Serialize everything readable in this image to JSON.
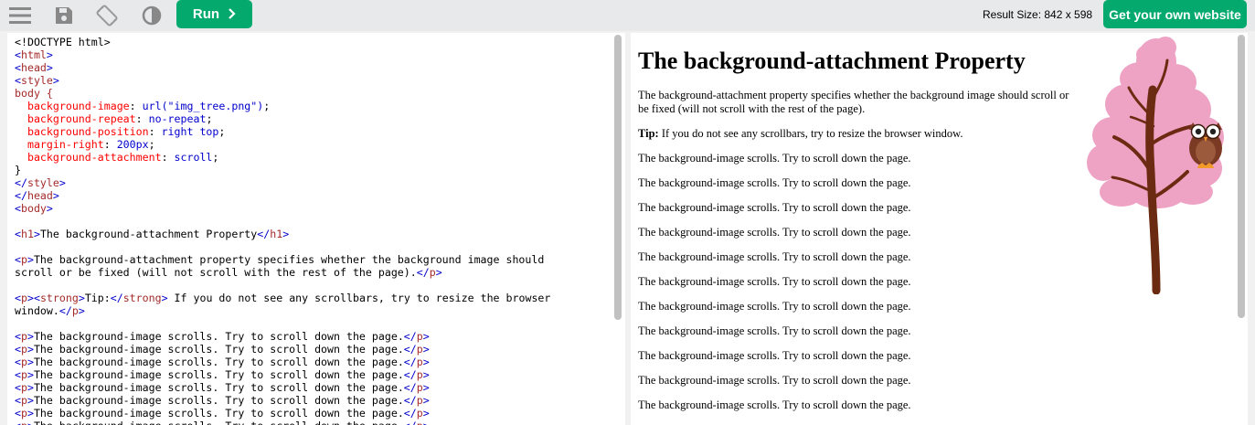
{
  "toolbar": {
    "run_label": "Run",
    "result_size": "Result Size: 842 x 598",
    "get_website_label": "Get your own website",
    "icons": [
      "menu-icon",
      "save-icon",
      "rotate-icon",
      "contrast-icon",
      "chevron-right-icon"
    ]
  },
  "code": {
    "doctype": "<!DOCTYPE html>",
    "css_selector": "body {",
    "css": [
      {
        "prop": "background-image",
        "value": "url(\"img_tree.png\")"
      },
      {
        "prop": "background-repeat",
        "value": "no-repeat"
      },
      {
        "prop": "background-position",
        "value": "right top"
      },
      {
        "prop": "margin-right",
        "value": "200px"
      },
      {
        "prop": "background-attachment",
        "value": "scroll"
      }
    ],
    "css_close": "}",
    "h1_text": "The background-attachment Property",
    "p1_line1": "The background-attachment property specifies whether the background image should",
    "p1_line2": "scroll or be fixed (will not scroll with the rest of the page).",
    "p2_strong": "Tip:",
    "p2_line1": " If you do not see any scrollbars, try to resize the browser",
    "p2_line2": "window.",
    "repeat_text": "The background-image scrolls. Try to scroll down the page."
  },
  "result": {
    "heading": "The background-attachment Property",
    "intro": "The background-attachment property specifies whether the background image should scroll or be fixed (will not scroll with the rest of the page).",
    "tip_label": "Tip:",
    "tip_text": " If you do not see any scrollbars, try to resize the browser window.",
    "scroll_line": "The background-image scrolls. Try to scroll down the page."
  },
  "colors": {
    "accent": "#04aa6d",
    "tree_blossom": "#eea2c4",
    "tree_trunk": "#6b2b12",
    "owl": "#7a3a24"
  }
}
